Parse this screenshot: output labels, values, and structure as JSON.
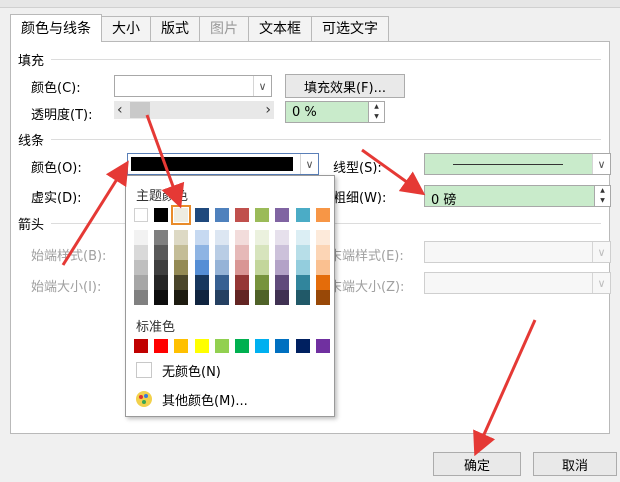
{
  "tabs": [
    "颜色与线条",
    "大小",
    "版式",
    "图片",
    "文本框",
    "可选文字"
  ],
  "fill": {
    "title": "填充",
    "color_label": "颜色(C):",
    "effects_button": "填充效果(F)...",
    "transparency_label": "透明度(T):",
    "transparency_value": "0 %"
  },
  "line": {
    "title": "线条",
    "color_label": "颜色(O):",
    "style_label": "线型(S):",
    "dash_label": "虚实(D):",
    "weight_label": "粗细(W):",
    "weight_value": "0 磅"
  },
  "arrows": {
    "title": "箭头",
    "begin_style": "始端样式(B):",
    "end_style": "末端样式(E):",
    "begin_size": "始端大小(I):",
    "end_size": "末端大小(Z):"
  },
  "picker": {
    "theme_title": "主题颜色",
    "standard_title": "标准色",
    "no_color": "无颜色(N)",
    "more_colors": "其他颜色(M)...",
    "theme_row": [
      "#ffffff",
      "#000000",
      "#eeece1",
      "#1f497d",
      "#4f81bd",
      "#c0504d",
      "#9bbb59",
      "#8064a2",
      "#4bacc6",
      "#f79646"
    ],
    "theme_shades": [
      [
        "#f2f2f2",
        "#d9d9d9",
        "#bfbfbf",
        "#a6a6a6",
        "#808080"
      ],
      [
        "#7f7f7f",
        "#595959",
        "#3f3f3f",
        "#262626",
        "#0d0d0d"
      ],
      [
        "#ddd9c4",
        "#c4bd97",
        "#948a54",
        "#4a452a",
        "#1d1b10"
      ],
      [
        "#c6d9f1",
        "#8eb4e3",
        "#558ed5",
        "#17375e",
        "#10243f"
      ],
      [
        "#dce6f2",
        "#b9cde5",
        "#95b3d7",
        "#376092",
        "#254061"
      ],
      [
        "#f2dcdb",
        "#e6b9b8",
        "#d99694",
        "#953735",
        "#632523"
      ],
      [
        "#ebf1de",
        "#d7e4bd",
        "#c3d69b",
        "#77933c",
        "#4f6228"
      ],
      [
        "#e6e0ec",
        "#ccc1da",
        "#b3a2c7",
        "#604a7b",
        "#403152"
      ],
      [
        "#dbeef4",
        "#b7dee8",
        "#93cddd",
        "#31859c",
        "#215968"
      ],
      [
        "#fdeada",
        "#fcd5b5",
        "#fac090",
        "#e46c0a",
        "#984807"
      ]
    ],
    "standard_row": [
      "#c00000",
      "#ff0000",
      "#ffc000",
      "#ffff00",
      "#92d050",
      "#00b050",
      "#00b0f0",
      "#0070c0",
      "#002060",
      "#7030a0"
    ]
  },
  "footer": {
    "ok": "确定",
    "cancel": "取消"
  }
}
